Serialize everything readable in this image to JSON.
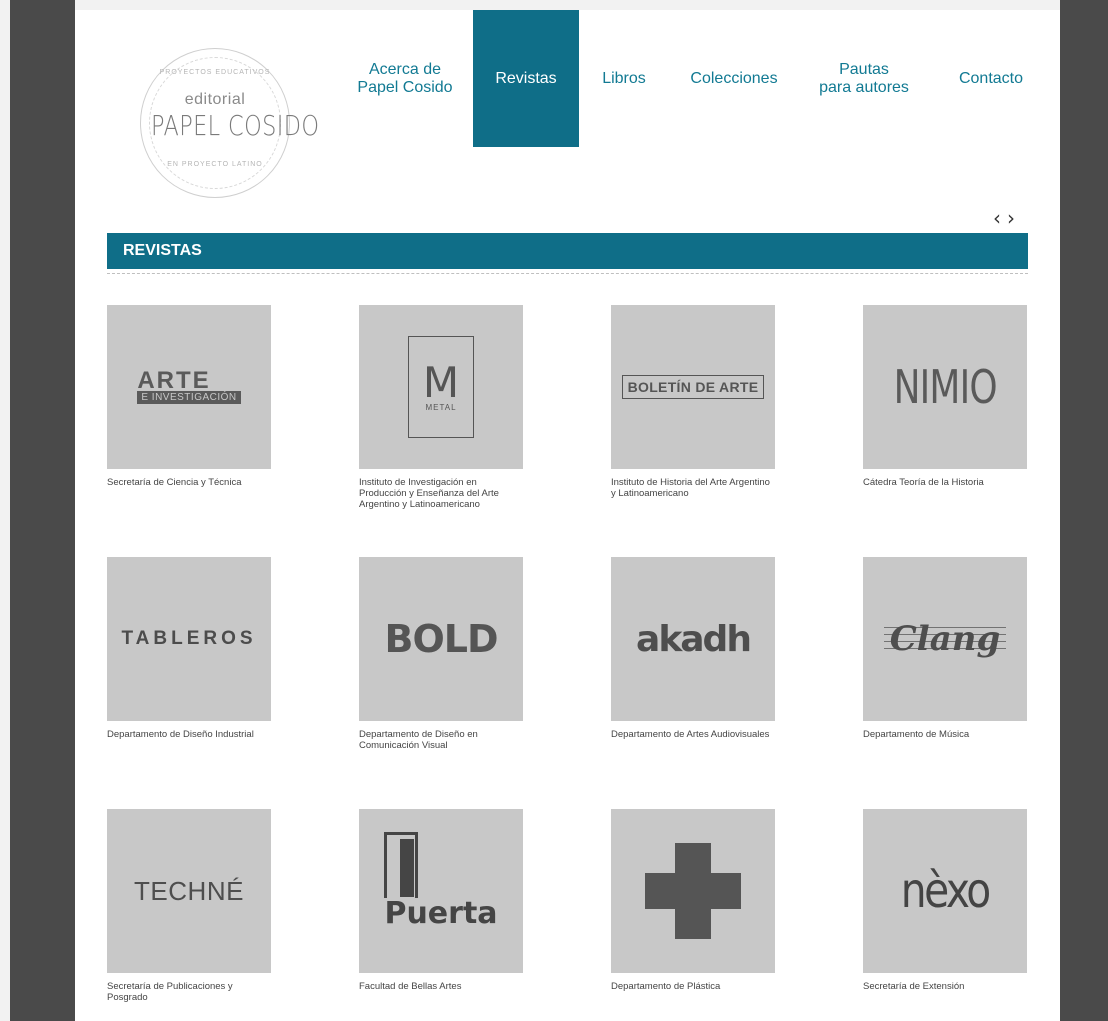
{
  "logo": {
    "top_arc": "PROYECTOS EDUCATIVOS",
    "small": "editorial",
    "big": "PAPEL COSIDO",
    "bottom_arc": "EN PROYECTO LATINO"
  },
  "nav": {
    "items": [
      {
        "label": "Acerca de\nPapel Cosido",
        "active": false
      },
      {
        "label": "Revistas",
        "active": true
      },
      {
        "label": "Libros",
        "active": false
      },
      {
        "label": "Colecciones",
        "active": false
      },
      {
        "label": "Pautas\npara autores",
        "active": false
      },
      {
        "label": "Contacto",
        "active": false
      }
    ]
  },
  "carousel": {
    "prev": "‹",
    "next": "›"
  },
  "section": {
    "title": "REVISTAS"
  },
  "magazines": [
    {
      "logo_text": "ARTE",
      "logo_sub": "E INVESTIGACIÓN",
      "caption": "Secretaría de Ciencia y Técnica"
    },
    {
      "logo_text": "M",
      "logo_sub": "METAL",
      "caption": "Instituto de Investigación en Producción y Enseñanza del Arte Argentino y Latinoamericano"
    },
    {
      "logo_text": "BOLETÍN DE ARTE",
      "caption": "Instituto de Historia del Arte Argentino y Latinoamericano"
    },
    {
      "logo_text": "NIMIO",
      "caption": "Cátedra Teoría de la Historia"
    },
    {
      "logo_text": "TABLEROS",
      "caption": "Departamento de Diseño Industrial"
    },
    {
      "logo_text": "BOLD",
      "caption": "Departamento de Diseño en Comunicación Visual"
    },
    {
      "logo_text": "akadh",
      "caption": "Departamento de Artes Audiovisuales"
    },
    {
      "logo_text": "Clang",
      "caption": "Departamento de Música"
    },
    {
      "logo_text": "TECHNÉ",
      "caption": "Secretaría de Publicaciones y Posgrado"
    },
    {
      "logo_text": "Puerta",
      "caption": "Facultad de Bellas Artes"
    },
    {
      "logo_text": "+",
      "caption": "Departamento de Plástica"
    },
    {
      "logo_text": "nèxo",
      "caption": "Secretaría de Extensión"
    }
  ]
}
